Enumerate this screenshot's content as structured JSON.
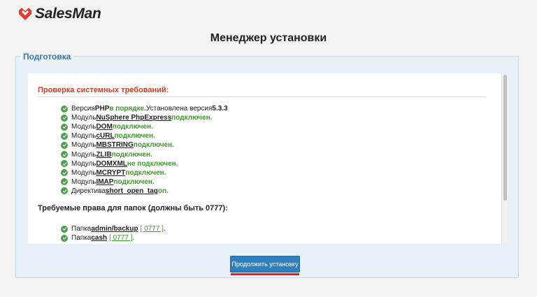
{
  "app": {
    "name": "SalesMan",
    "brand_color": "#e03c31"
  },
  "page": {
    "title": "Менеджер установки"
  },
  "panel": {
    "legend": "Подготовка",
    "system_requirements": {
      "title": "Проверка системных требований:",
      "items": [
        {
          "icon": "check-icon",
          "parts": [
            {
              "t": "Версия "
            },
            {
              "t": "PHP",
              "s": "b"
            },
            {
              "t": " в порядке.",
              "s": "ok"
            },
            {
              "t": " Установлена версия "
            },
            {
              "t": "5.3.3",
              "s": "b"
            }
          ]
        },
        {
          "icon": "check-icon",
          "parts": [
            {
              "t": "Модуль "
            },
            {
              "t": "NuSphere PhpExpress",
              "s": "u"
            },
            {
              "t": " подключен.",
              "s": "ok"
            }
          ]
        },
        {
          "icon": "check-icon",
          "parts": [
            {
              "t": "Модуль "
            },
            {
              "t": "DOM",
              "s": "u"
            },
            {
              "t": " подключен.",
              "s": "ok"
            }
          ]
        },
        {
          "icon": "check-icon",
          "parts": [
            {
              "t": "Модуль "
            },
            {
              "t": "cURL",
              "s": "u"
            },
            {
              "t": " подключен.",
              "s": "ok"
            }
          ]
        },
        {
          "icon": "check-icon",
          "parts": [
            {
              "t": "Модуль "
            },
            {
              "t": "MBSTRING",
              "s": "u"
            },
            {
              "t": " подключен.",
              "s": "ok"
            }
          ]
        },
        {
          "icon": "check-icon",
          "parts": [
            {
              "t": "Модуль "
            },
            {
              "t": "ZLIB",
              "s": "u"
            },
            {
              "t": " подключен.",
              "s": "ok"
            }
          ]
        },
        {
          "icon": "check-icon",
          "parts": [
            {
              "t": "Модуль "
            },
            {
              "t": "DOMXML",
              "s": "u"
            },
            {
              "t": " не подключен.",
              "s": "ok"
            }
          ]
        },
        {
          "icon": "check-icon",
          "parts": [
            {
              "t": "Модуль "
            },
            {
              "t": "MCRYPT",
              "s": "u"
            },
            {
              "t": " подключен.",
              "s": "ok"
            }
          ]
        },
        {
          "icon": "check-icon",
          "parts": [
            {
              "t": "Модуль "
            },
            {
              "t": "IMAP",
              "s": "u"
            },
            {
              "t": " подключен.",
              "s": "ok"
            }
          ]
        },
        {
          "icon": "check-icon",
          "parts": [
            {
              "t": "Директива "
            },
            {
              "t": "short_open_tag",
              "s": "u"
            },
            {
              "t": " on.",
              "s": "ok"
            }
          ]
        }
      ]
    },
    "folder_permissions": {
      "title": "Требуемые права для папок (должны быть 0777):",
      "items": [
        {
          "icon": "check-icon",
          "parts": [
            {
              "t": "Папка "
            },
            {
              "t": "admin/backup",
              "s": "u"
            },
            {
              "t": "[ 0777 ]",
              "s": "link"
            },
            {
              "t": "."
            }
          ]
        },
        {
          "icon": "check-icon",
          "parts": [
            {
              "t": "Папка "
            },
            {
              "t": "cash",
              "s": "u"
            },
            {
              "t": "[ 0777 ]",
              "s": "link"
            },
            {
              "t": "."
            }
          ]
        }
      ]
    },
    "continue_button": {
      "label": "Продолжить установку"
    }
  },
  "colors": {
    "accent": "#2d7fbd",
    "success": "#4aa14a",
    "error_heading": "#d63a1e",
    "legend": "#2e78b6"
  }
}
